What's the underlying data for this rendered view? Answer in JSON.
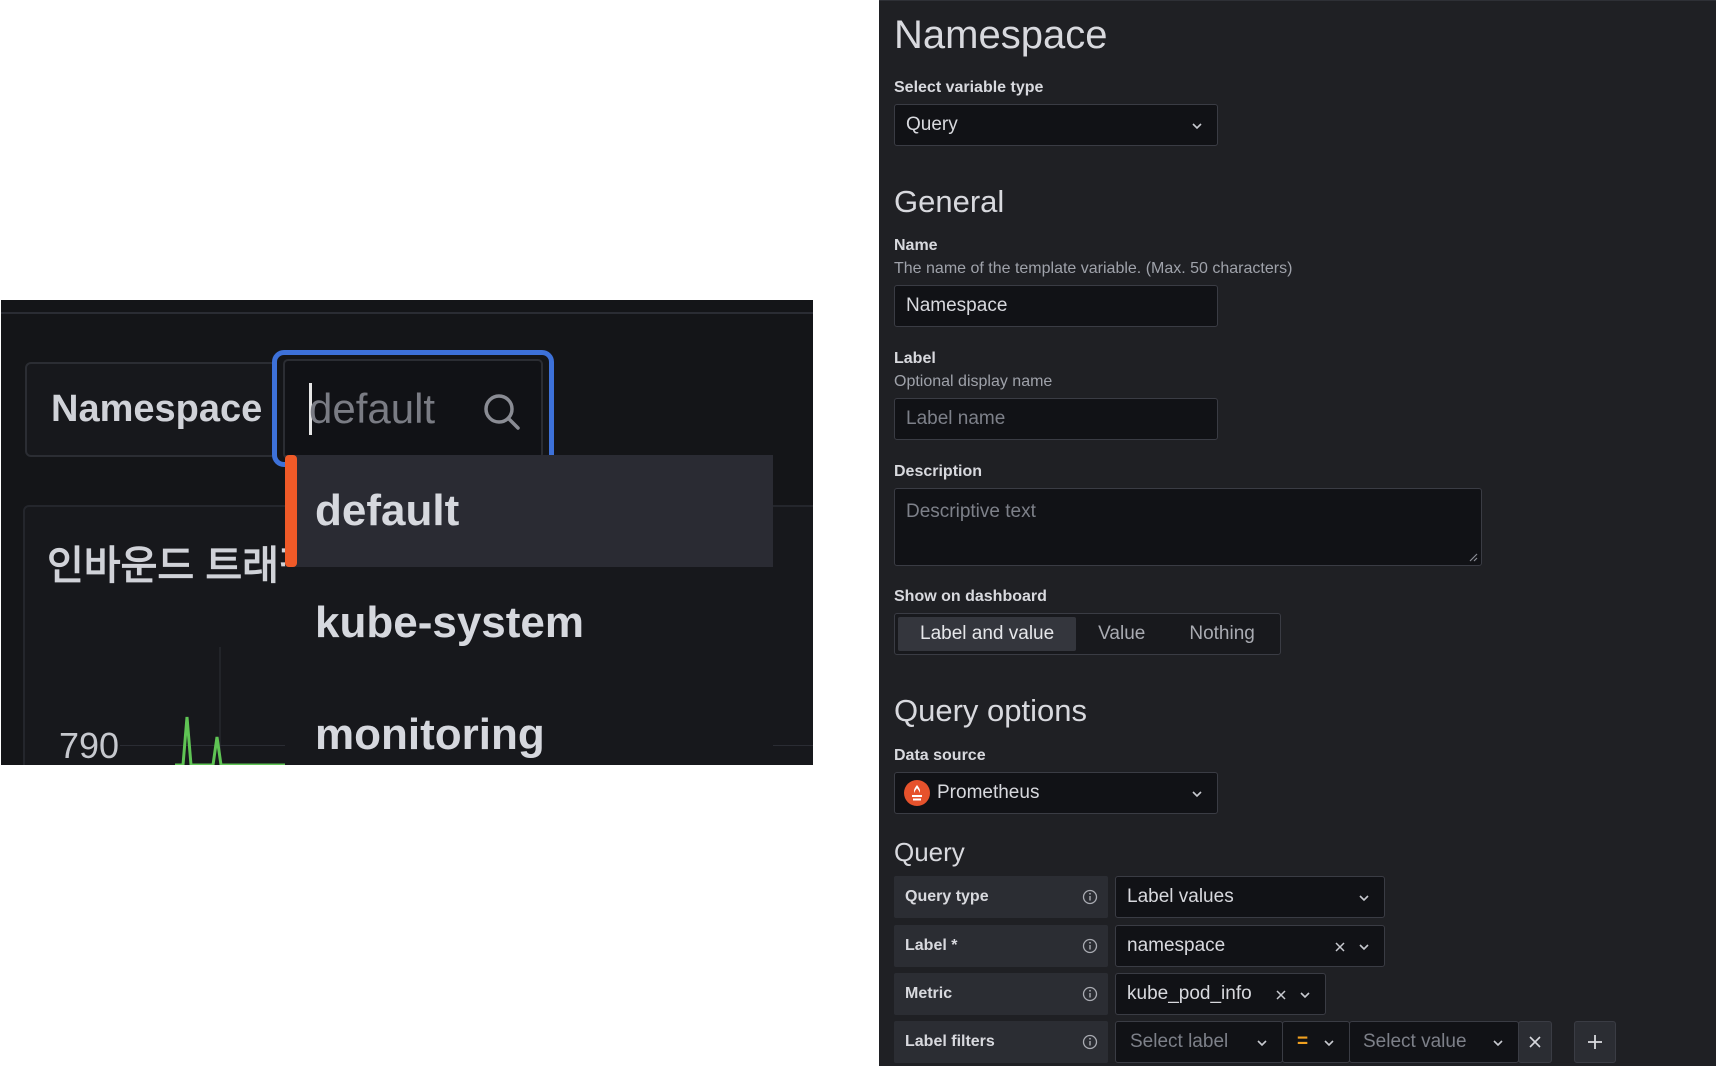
{
  "zoom": {
    "variable_label": "Namespace",
    "picker_value": "default",
    "panel_title": "인바운드 트래픽",
    "y_tick": "790",
    "options": [
      "default",
      "kube-system",
      "monitoring"
    ],
    "accent_color": "#f05a28",
    "focus_color": "#3d71d9"
  },
  "editor": {
    "title": "Namespace",
    "variable_type": {
      "label": "Select variable type",
      "value": "Query"
    },
    "general": {
      "heading": "General",
      "name_label": "Name",
      "name_desc": "The name of the template variable. (Max. 50 characters)",
      "name_value": "Namespace",
      "label_label": "Label",
      "label_desc": "Optional display name",
      "label_placeholder": "Label name",
      "description_label": "Description",
      "description_placeholder": "Descriptive text",
      "show_label": "Show on dashboard",
      "show_options": [
        "Label and value",
        "Value",
        "Nothing"
      ],
      "show_selected": "Label and value"
    },
    "query_options": {
      "heading": "Query options",
      "datasource_label": "Data source",
      "datasource_value": "Prometheus"
    },
    "query": {
      "heading": "Query",
      "query_type_label": "Query type",
      "query_type_value": "Label values",
      "label_row_label": "Label *",
      "label_row_value": "namespace",
      "metric_label": "Metric",
      "metric_value": "kube_pod_info",
      "filters_label": "Label filters",
      "filter_label_placeholder": "Select label",
      "filter_operator": "=",
      "filter_value_placeholder": "Select value"
    }
  }
}
